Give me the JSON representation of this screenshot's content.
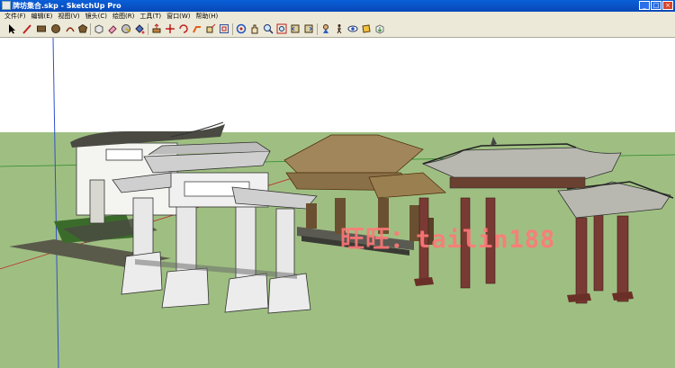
{
  "window": {
    "title": "牌坊集合.skp - SketchUp Pro",
    "buttons": {
      "minimize": "_",
      "maximize": "□",
      "close": "×"
    }
  },
  "menubar": {
    "items": [
      "文件(F)",
      "编辑(E)",
      "视图(V)",
      "镜头(C)",
      "绘图(R)",
      "工具(T)",
      "窗口(W)",
      "帮助(H)"
    ]
  },
  "toolbar": {
    "tools": [
      "select-icon",
      "line-icon",
      "rectangle-icon",
      "circle-icon",
      "arc-icon",
      "polygon-icon",
      "make-component-icon",
      "eraser-icon",
      "tape-measure-icon",
      "paint-bucket-icon",
      "push-pull-icon",
      "move-icon",
      "rotate-icon",
      "follow-me-icon",
      "scale-icon",
      "offset-icon",
      "orbit-icon",
      "pan-icon",
      "zoom-icon",
      "zoom-extents-icon",
      "previous-view-icon",
      "next-view-icon",
      "position-camera-icon",
      "walk-icon",
      "look-around-icon",
      "section-plane-icon",
      "get-models-icon",
      "share-model-icon",
      "component-icon"
    ]
  },
  "scene": {
    "sky_color": "#ffffff",
    "ground_color": "#9fbf82",
    "watermark": "旺旺：tailin188"
  }
}
